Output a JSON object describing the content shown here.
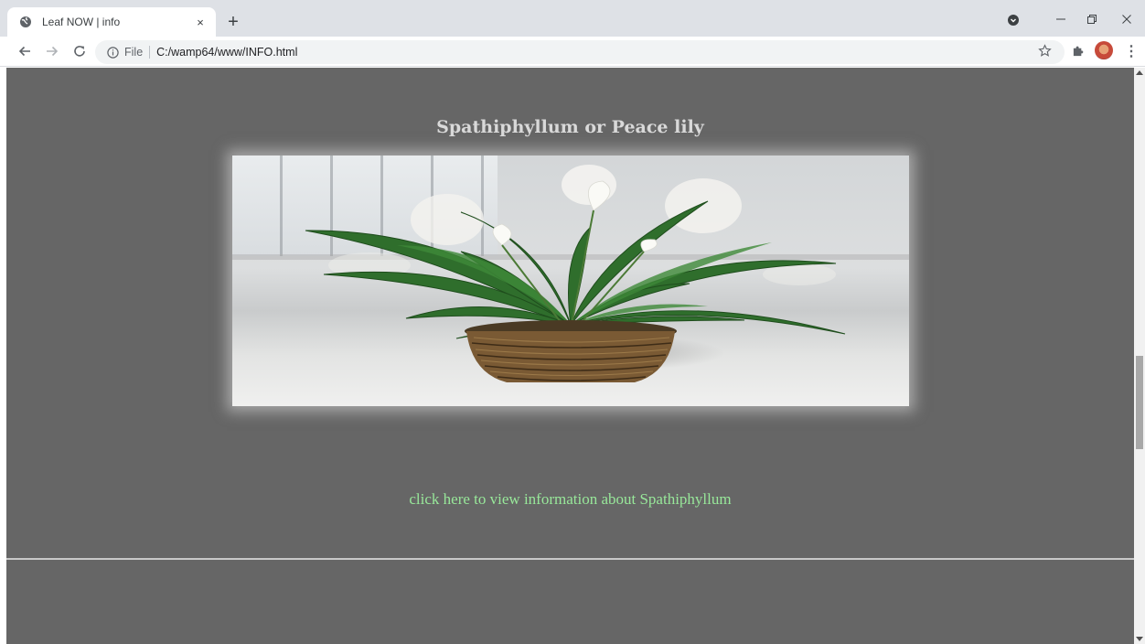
{
  "browser": {
    "tab_title": "Leaf NOW | info",
    "tab_close_glyph": "×",
    "new_tab_glyph": "+",
    "menu_glyph": "⋮",
    "url_scheme": "File",
    "url": "C:/wamp64/www/INFO.html",
    "icons": [
      "globe-icon",
      "close-icon",
      "plus-icon",
      "tab-search-icon",
      "minimize-icon",
      "restore-icon",
      "window-close-icon",
      "back-arrow-icon",
      "forward-arrow-icon",
      "reload-icon",
      "info-icon",
      "star-icon",
      "puzzle-icon",
      "avatar",
      "kebab-menu-icon"
    ]
  },
  "page": {
    "heading": "Spathiphyllum or Peace lily",
    "link_text": "click here to view information about Spathiphyllum",
    "colors": {
      "background": "#666666",
      "heading": "#d9d9d9",
      "link": "#98e89a",
      "divider": "#c8c8c8"
    }
  }
}
